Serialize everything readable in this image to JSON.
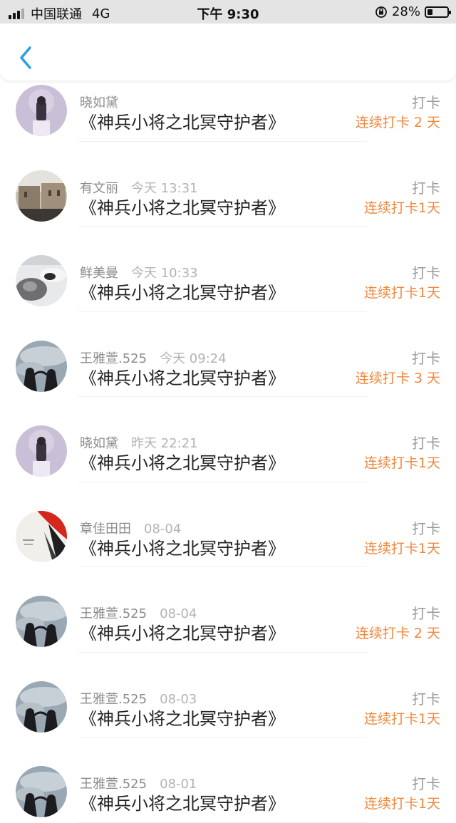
{
  "status_bar": {
    "carrier": "中国联通",
    "network": "4G",
    "time": "下午 9:30",
    "battery": "28%",
    "battery_level": 0.28
  },
  "nav": {
    "back_icon": "chevron-left-icon",
    "accent": "#2a9ee8"
  },
  "colors": {
    "streak": "#f0883e",
    "muted": "#9a9a9a",
    "title": "#222222"
  },
  "records": [
    {
      "user": "晓如黛",
      "time": "",
      "book": "《神兵小将之北冥守护者》",
      "action": "打卡",
      "streak": "连续打卡 2 天",
      "avatar": "lilac"
    },
    {
      "user": "有文丽",
      "time": "今天 13:31",
      "book": "《神兵小将之北冥守护者》",
      "action": "打卡",
      "streak": "连续打卡1天",
      "avatar": "street"
    },
    {
      "user": "鲜美曼",
      "time": "今天 10:33",
      "book": "《神兵小将之北冥守护者》",
      "action": "打卡",
      "streak": "连续打卡1天",
      "avatar": "cat"
    },
    {
      "user": "王雅萱.525",
      "time": "今天 09:24",
      "book": "《神兵小将之北冥守护者》",
      "action": "打卡",
      "streak": "连续打卡 3 天",
      "avatar": "sky"
    },
    {
      "user": "晓如黛",
      "time": "昨天 22:21",
      "book": "《神兵小将之北冥守护者》",
      "action": "打卡",
      "streak": "连续打卡1天",
      "avatar": "lilac"
    },
    {
      "user": "章佳田田",
      "time": "08-04",
      "book": "《神兵小将之北冥守护者》",
      "action": "打卡",
      "streak": "连续打卡1天",
      "avatar": "red"
    },
    {
      "user": "王雅萱.525",
      "time": "08-04",
      "book": "《神兵小将之北冥守护者》",
      "action": "打卡",
      "streak": "连续打卡 2 天",
      "avatar": "sky"
    },
    {
      "user": "王雅萱.525",
      "time": "08-03",
      "book": "《神兵小将之北冥守护者》",
      "action": "打卡",
      "streak": "连续打卡1天",
      "avatar": "sky"
    },
    {
      "user": "王雅萱.525",
      "time": "08-01",
      "book": "《神兵小将之北冥守护者》",
      "action": "打卡",
      "streak": "连续打卡1天",
      "avatar": "sky"
    }
  ]
}
